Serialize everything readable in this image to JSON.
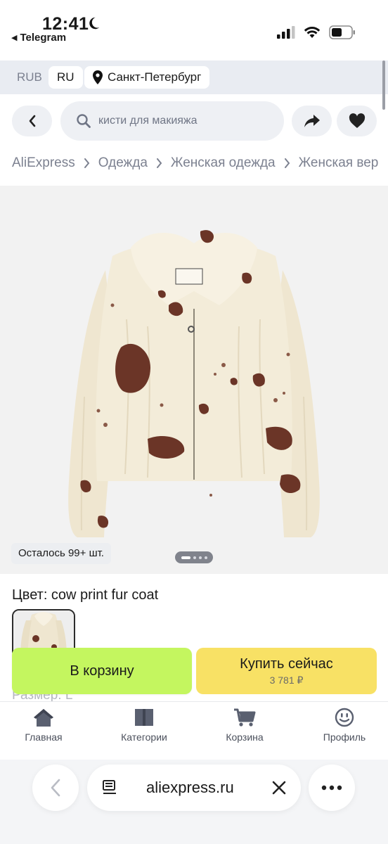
{
  "status_bar": {
    "time": "12:41",
    "back_app": "Telegram",
    "icons": [
      "moon-icon",
      "signal-icon",
      "wifi-icon",
      "battery-icon"
    ]
  },
  "region": {
    "currency": "RUB",
    "language": "RU",
    "city": "Санкт-Петербург"
  },
  "search": {
    "placeholder": "кисти для макияжа"
  },
  "breadcrumbs": [
    "AliExpress",
    "Одежда",
    "Женская одежда",
    "Женская вер"
  ],
  "product": {
    "stock_text": "Осталось 99+ шт.",
    "gallery_pages": 4,
    "gallery_active": 0,
    "color_label": "Цвет: cow print fur coat",
    "size_label": "Размер: L"
  },
  "actions": {
    "cart_label": "В корзину",
    "buy_label": "Купить сейчас",
    "buy_price": "3 781 ₽"
  },
  "nav": {
    "home": "Главная",
    "categories": "Категории",
    "cart": "Корзина",
    "profile": "Профиль"
  },
  "browser": {
    "url": "aliexpress.ru"
  },
  "colors": {
    "cart_button": "#c4f65f",
    "buy_button": "#f8e165",
    "region_bar": "#e9ecf2"
  }
}
